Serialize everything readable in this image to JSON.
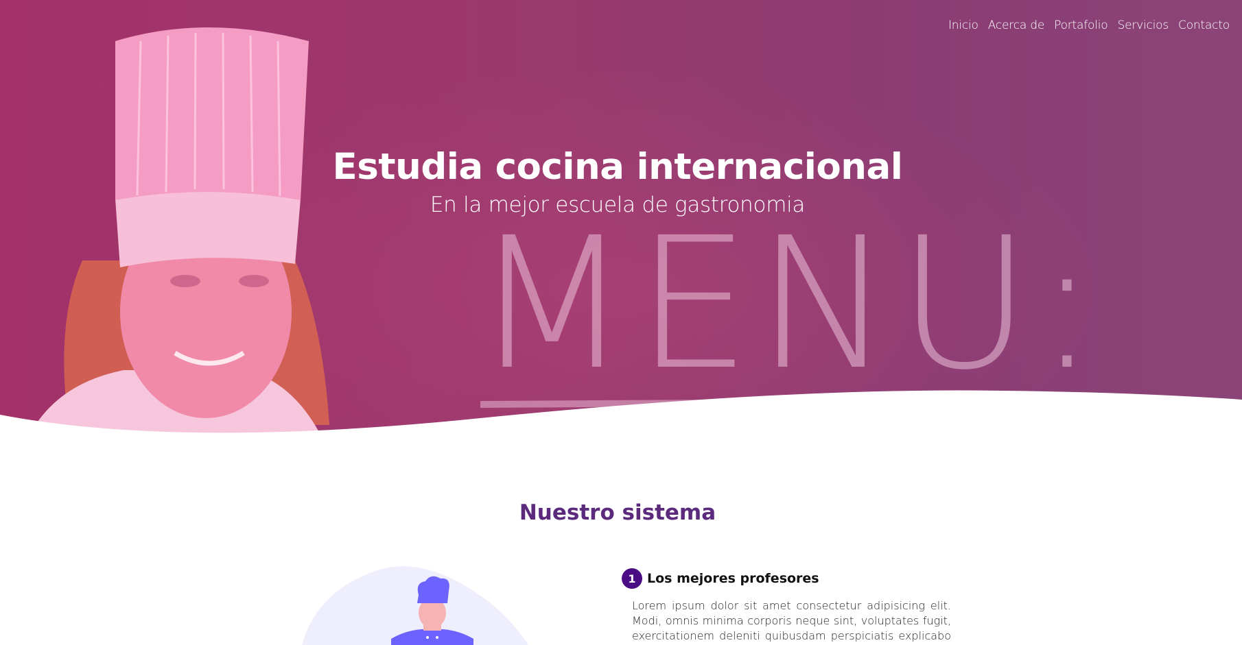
{
  "nav": {
    "items": [
      "Inicio",
      "Acerca de",
      "Portafolio",
      "Servicios",
      "Contacto"
    ]
  },
  "hero": {
    "title": "Estudia cocina internacional",
    "subtitle": "En la mejor escuela de gastronomia",
    "board_text": "MENU:",
    "overlay_color": "#9b356e"
  },
  "section": {
    "title": "Nuestro sistema",
    "features": [
      {
        "number": "1",
        "title": "Los mejores profesores",
        "text": "Lorem ipsum dolor sit amet consectetur adipisicing elit. Modi, omnis minima corporis neque sint, voluptates fugit, exercitationem deleniti quibusdam perspiciatis explicabo ut a"
      }
    ]
  },
  "colors": {
    "accent": "#5b2a7d",
    "badge": "#4b0d84",
    "illustration": "#6c63ff"
  }
}
